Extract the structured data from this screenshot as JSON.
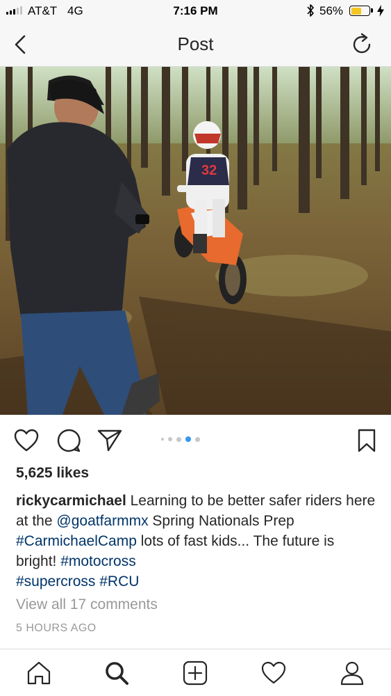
{
  "status_bar": {
    "carrier": "AT&T",
    "network": "4G",
    "time": "7:16 PM",
    "battery_percent": "56%",
    "battery_level": 0.56,
    "battery_color": "#f5c623",
    "icons": [
      "signal-bars-icon",
      "bluetooth-icon",
      "battery-icon",
      "charging-bolt-icon"
    ]
  },
  "header": {
    "title": "Post",
    "back_icon": "chevron-left-icon",
    "refresh_icon": "refresh-icon"
  },
  "post": {
    "image_description": "photo",
    "carousel": {
      "count": 5,
      "active_index": 3
    },
    "likes": "5,625 likes",
    "caption": {
      "username": "ricky­carmichael",
      "text1": " Learning to be better safer riders here at the ",
      "mention": "@goatfarmmx",
      "text2": " Spring Nationals Prep ",
      "hashtag1": "#CarmichaelCamp",
      "text3": " lots of fast kids... The future is bright! ",
      "hashtag2": "#motocross",
      "space": " ",
      "hashtag3": "#supercross",
      "hashtag4": "#RCU"
    },
    "comments_link": "View all 17 comments",
    "time_ago": "5 HOURS AGO"
  },
  "actions": {
    "icons": [
      "heart-icon",
      "comment-icon",
      "share-icon",
      "bookmark-icon"
    ]
  },
  "tabbar": {
    "icons": [
      "home-icon",
      "search-icon",
      "add-post-icon",
      "activity-heart-icon",
      "profile-icon"
    ],
    "active": "search-icon"
  },
  "colors": {
    "link": "#003569",
    "text": "#262626",
    "muted": "#999999",
    "active_dot": "#3897f0",
    "bar_bg": "#f7f7f7"
  }
}
